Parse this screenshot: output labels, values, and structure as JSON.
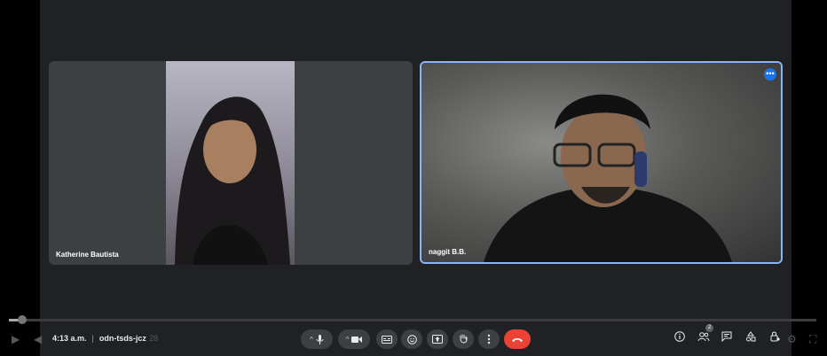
{
  "participants": [
    {
      "name": "Katherine Bautista"
    },
    {
      "name": "naggit B.B."
    }
  ],
  "tile_menu_label": "•••",
  "meeting": {
    "time": "4:13 a.m.",
    "separator": "|",
    "code": "odn-tsds-jcz"
  },
  "player": {
    "progress_fraction": 0.016,
    "elapsed_ghost": "28"
  },
  "toolbar": {
    "mic_chevron": "^",
    "cam_chevron": "^"
  },
  "people_count": "2",
  "colors": {
    "accent": "#8ab4f8",
    "end_call": "#ea4335",
    "background": "#202124",
    "tile": "#3c4043"
  }
}
